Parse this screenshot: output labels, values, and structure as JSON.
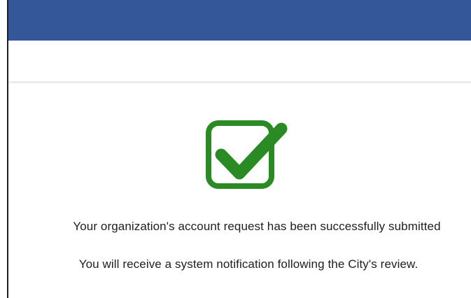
{
  "header": {
    "bar_color": "#34579a"
  },
  "status": {
    "icon": "checkmark-success-icon",
    "icon_color": "#2a8a23"
  },
  "messages": {
    "primary": "Your organization's account request has been successfully submitted",
    "secondary": "You will receive a system notification following the City's review."
  }
}
